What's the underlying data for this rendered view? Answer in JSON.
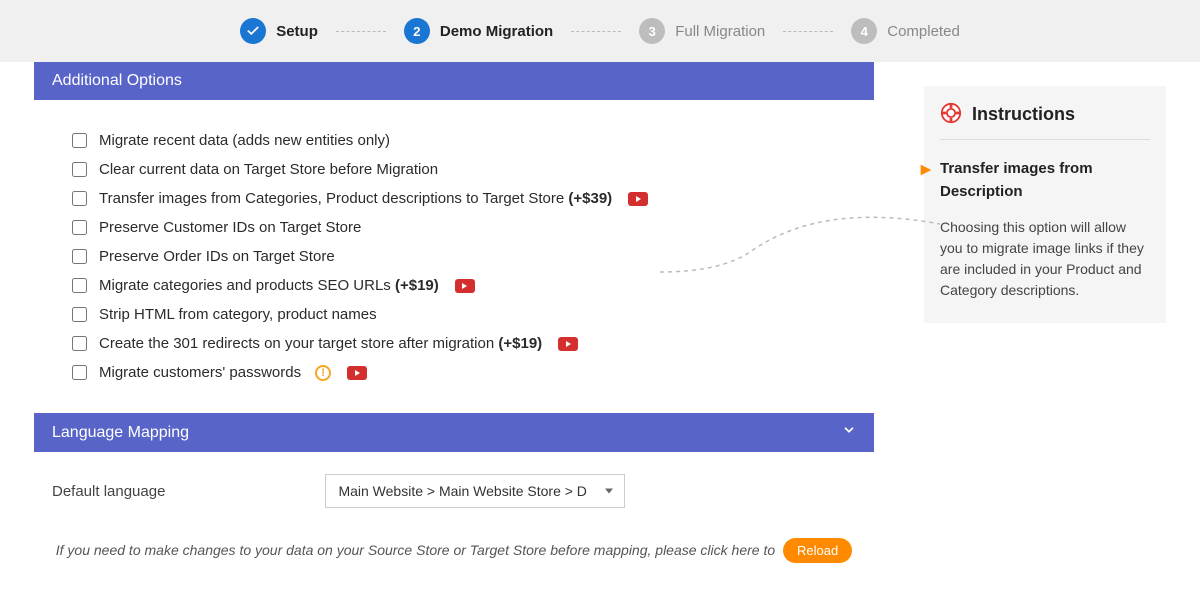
{
  "stepper": {
    "steps": [
      {
        "label": "Setup",
        "state": "done"
      },
      {
        "label": "Demo Migration",
        "state": "active",
        "num": "2"
      },
      {
        "label": "Full Migration",
        "state": "inactive",
        "num": "3"
      },
      {
        "label": "Completed",
        "state": "inactive",
        "num": "4"
      }
    ]
  },
  "panels": {
    "additional_options": {
      "title": "Additional Options",
      "options": [
        {
          "label": "Migrate recent data (adds new entities only)",
          "price": "",
          "video": false,
          "warn": false
        },
        {
          "label": "Clear current data on Target Store before Migration",
          "price": "",
          "video": false,
          "warn": false
        },
        {
          "label": "Transfer images from Categories, Product descriptions to Target Store ",
          "price": "(+$39)",
          "video": true,
          "warn": false
        },
        {
          "label": "Preserve Customer IDs on Target Store",
          "price": "",
          "video": false,
          "warn": false
        },
        {
          "label": "Preserve Order IDs on Target Store",
          "price": "",
          "video": false,
          "warn": false
        },
        {
          "label": "Migrate categories and products SEO URLs ",
          "price": "(+$19)",
          "video": true,
          "warn": false
        },
        {
          "label": "Strip HTML from category, product names",
          "price": "",
          "video": false,
          "warn": false
        },
        {
          "label": "Create the 301 redirects on your target store after migration ",
          "price": "(+$19)",
          "video": true,
          "warn": false
        },
        {
          "label": "Migrate customers' passwords ",
          "price": "",
          "video": true,
          "warn": true
        }
      ]
    },
    "language_mapping": {
      "title": "Language Mapping",
      "default_label": "Default language",
      "select_value": "Main Website > Main Website Store > D",
      "hint_text": "If you need to make changes to your data on your Source Store or Target Store before mapping, please click here to ",
      "reload_label": "Reload"
    }
  },
  "sidebar": {
    "title": "Instructions",
    "subhead": "Transfer images from Description",
    "desc": "Choosing this option will allow you to migrate image links if they are included in your Product and Category descriptions."
  }
}
